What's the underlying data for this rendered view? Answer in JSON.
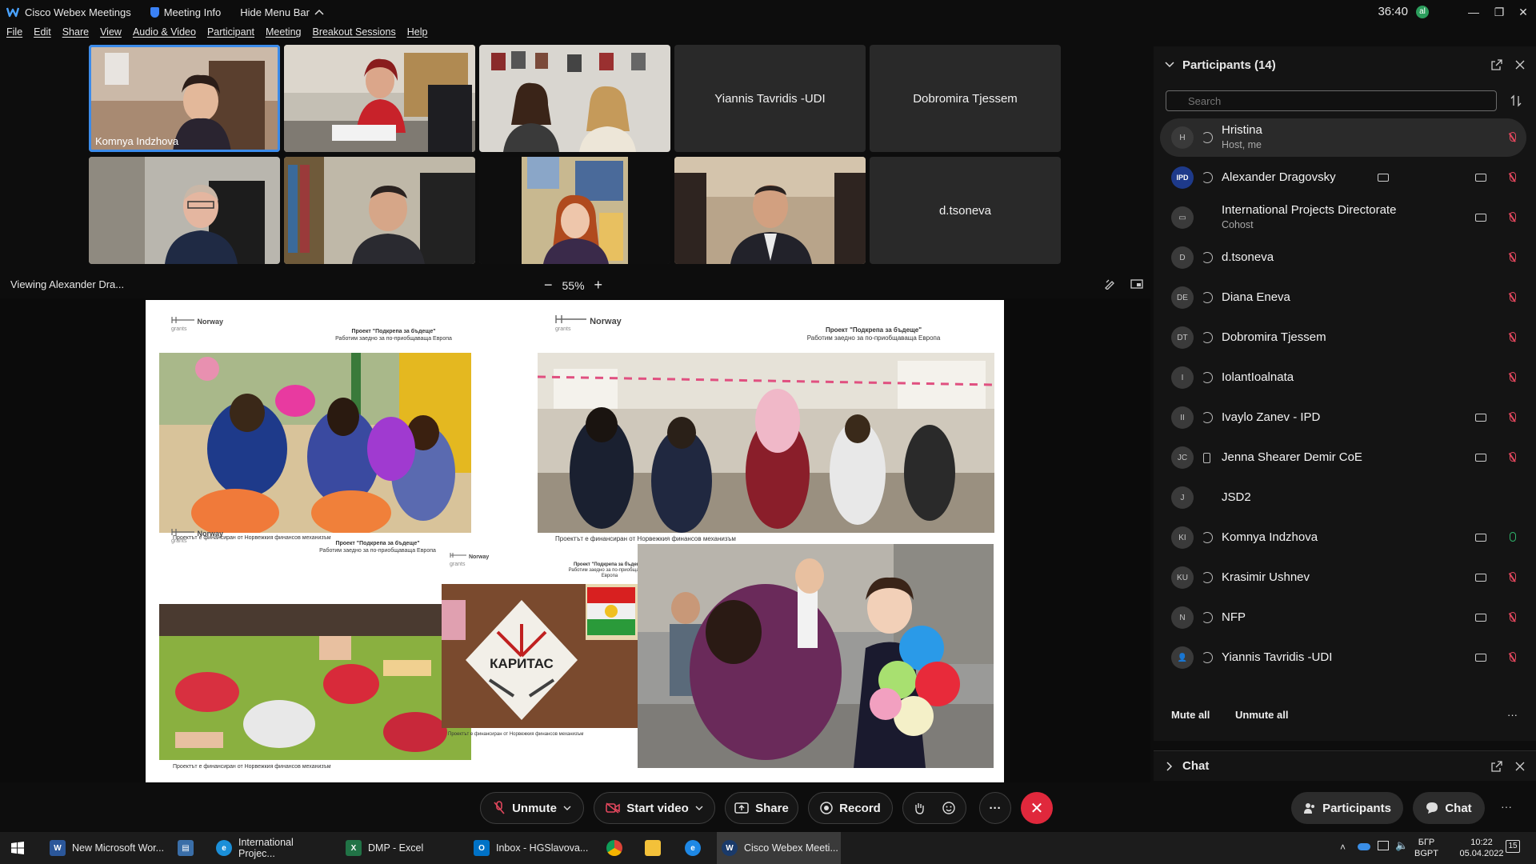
{
  "titlebar": {
    "app_name": "Cisco Webex Meetings",
    "meeting_info": "Meeting Info",
    "hide_menu": "Hide Menu Bar",
    "timer": "36:40",
    "timer_badge": "al"
  },
  "menu": [
    "File",
    "Edit",
    "Share",
    "View",
    "Audio & Video",
    "Participant",
    "Meeting",
    "Breakout Sessions",
    "Help"
  ],
  "videos": {
    "tile1_label": "Komnya Indzhova",
    "tile_names": [
      "Yiannis Tavridis -UDI",
      "Dobromira Tjessem",
      "d.tsoneva"
    ]
  },
  "viewing": "Viewing Alexander Dra...",
  "zoom": {
    "minus": "−",
    "value": "55%",
    "plus": "+"
  },
  "slide": {
    "logo_text": "Norway",
    "logo_sub": "grants",
    "header_line1": "Проект \"Подкрепа за бъдеще\"",
    "header_line2": "Работим заедно за по-приобщаваща Европа",
    "caption": "Проектът е финансиран от Норвежкия финансов механизъм",
    "small_header1": "Проект \"Подкрепа за бъдеще\"",
    "small_header2": "Работим заедно за по-приобщаваща Европа",
    "caritas": "КАРИТАС"
  },
  "participants": {
    "title": "Participants (14)",
    "search_placeholder": "Search",
    "list": [
      {
        "initials": "H",
        "name": "Hristina",
        "role": "Host, me"
      },
      {
        "initials": "IPD",
        "name": "Alexander Dragovsky",
        "role": ""
      },
      {
        "initials": "▭",
        "name": "International Projects Directorate",
        "role": "Cohost"
      },
      {
        "initials": "D",
        "name": "d.tsoneva",
        "role": ""
      },
      {
        "initials": "DE",
        "name": "Diana Eneva",
        "role": ""
      },
      {
        "initials": "DT",
        "name": "Dobromira Tjessem",
        "role": ""
      },
      {
        "initials": "I",
        "name": "IolantIoalnata",
        "role": ""
      },
      {
        "initials": "II",
        "name": "Ivaylo Zanev - IPD",
        "role": ""
      },
      {
        "initials": "JC",
        "name": "Jenna Shearer Demir CoE",
        "role": ""
      },
      {
        "initials": "J",
        "name": "JSD2",
        "role": ""
      },
      {
        "initials": "KI",
        "name": "Komnya Indzhova",
        "role": ""
      },
      {
        "initials": "KU",
        "name": "Krasimir Ushnev",
        "role": ""
      },
      {
        "initials": "N",
        "name": "NFP",
        "role": ""
      },
      {
        "initials": "👤",
        "name": "Yiannis Tavridis -UDI",
        "role": ""
      }
    ],
    "mute_all": "Mute all",
    "unmute_all": "Unmute all",
    "more": "···"
  },
  "chat_section": "Chat",
  "controls": {
    "unmute": "Unmute",
    "start_video": "Start video",
    "share": "Share",
    "record": "Record",
    "more": "···",
    "participants": "Participants",
    "chat": "Chat",
    "overflow": "···"
  },
  "taskbar": {
    "items": [
      "New Microsoft Wor...",
      "International Projec...",
      "DMP - Excel",
      "Inbox - HGSlavova...",
      "Cisco Webex Meeti..."
    ],
    "lang1": "БГР",
    "lang2": "BGPT",
    "time": "10:22",
    "date": "05.04.2022",
    "notif": "15"
  }
}
